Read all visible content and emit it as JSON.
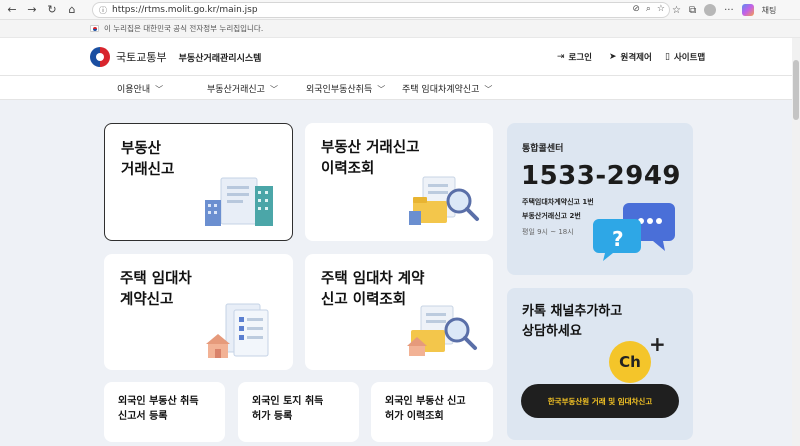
{
  "browser": {
    "url": "https://rtms.molit.go.kr/main.jsp",
    "back_icon": "←",
    "forward_icon": "→",
    "reload_icon": "↻",
    "home_icon": "⌂",
    "more_icon": "···",
    "copilot_label": "채팅"
  },
  "gov_banner": {
    "text": "이 누리집은 대한민국 공식 전자정부 누리집입니다."
  },
  "header": {
    "ministry": "국토교통부",
    "system_name": "부동산거래관리시스템",
    "utils": [
      {
        "label": "로그인",
        "icon": "⇥"
      },
      {
        "label": "원격제어",
        "icon": "➤"
      },
      {
        "label": "사이트맵",
        "icon": "▯"
      }
    ]
  },
  "gnb": {
    "items": [
      {
        "label": "이용안내"
      },
      {
        "label": "부동산거래신고"
      },
      {
        "label": "외국인부동산취득"
      },
      {
        "label": "주택 임대차계약신고"
      }
    ],
    "chevron": "﹀"
  },
  "cards": {
    "trade_report": {
      "title": "부동산\n거래신고"
    },
    "trade_history": {
      "title": "부동산 거래신고\n이력조회"
    },
    "lease_report": {
      "title": "주택 임대차\n계약신고"
    },
    "lease_history": {
      "title": "주택 임대차 계약\n신고 이력조회"
    },
    "foreign_acq": {
      "title": "외국인 부동산 취득\n신고서 등록"
    },
    "foreign_land": {
      "title": "외국인 토지 취득\n허가 등록"
    },
    "foreign_history": {
      "title": "외국인 부동산 신고\n허가 이력조회"
    }
  },
  "call_center": {
    "label": "통합콜센터",
    "number": "1533-2949",
    "line1": "주택임대차계약신고 1번",
    "line2": "부동산거래신고 2번",
    "hours": "평일 9시 ~ 18시"
  },
  "kakao": {
    "title": "카톡 채널추가하고\n상담하세요",
    "badge": "Ch",
    "plus": "+",
    "button": "한국부동산원 거래 및 임대차신고"
  },
  "colors": {
    "accent_kakao": "#f4c52a",
    "panel_bg": "#dde6f1",
    "page_bg": "#eef1f6"
  }
}
